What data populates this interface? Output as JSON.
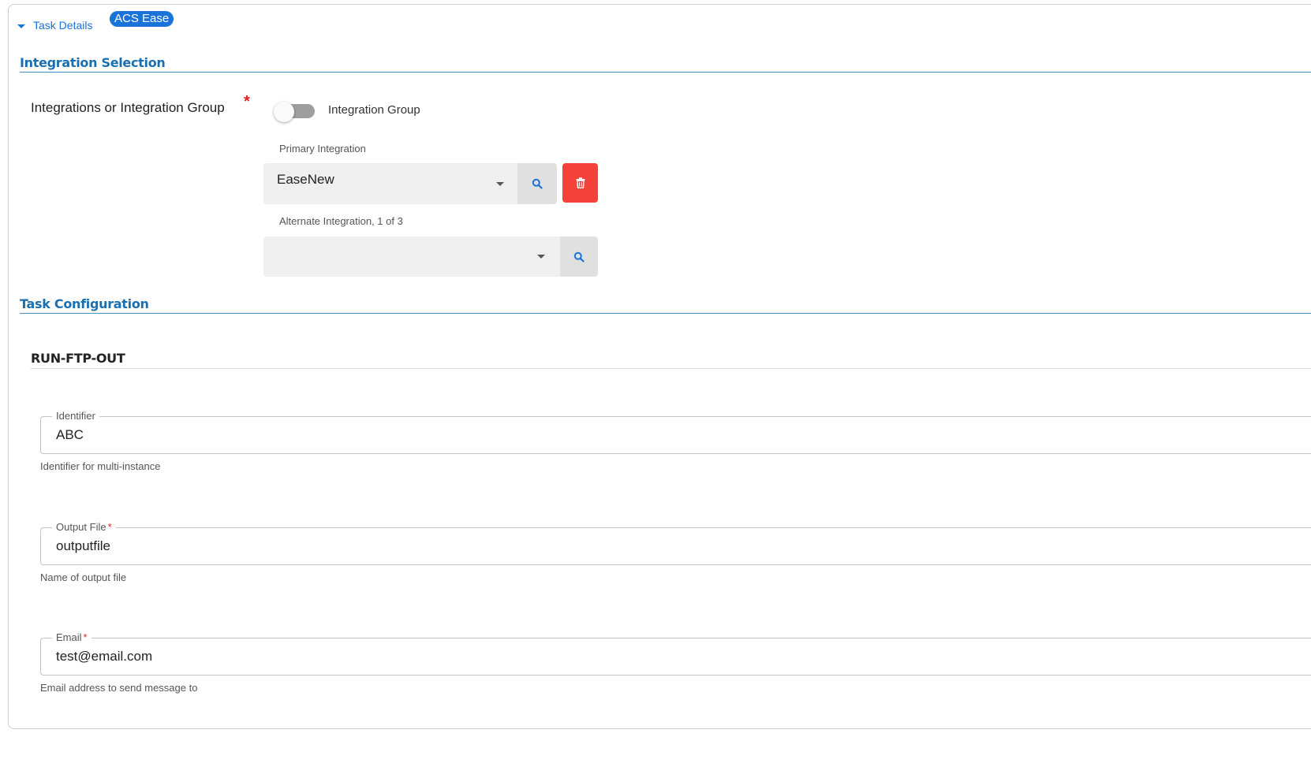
{
  "header": {
    "task_details_label": "Task Details",
    "badge": "ACS Ease"
  },
  "integration_selection": {
    "title": "Integration Selection",
    "field_label": "Integrations or Integration Group",
    "required_mark": "*",
    "toggle": {
      "label": "Integration Group",
      "on": false
    },
    "primary": {
      "label": "Primary Integration",
      "value": "EaseNew"
    },
    "alternate": {
      "label": "Alternate Integration, 1 of 3",
      "value": ""
    }
  },
  "task_configuration": {
    "title": "Task Configuration",
    "task_name": "RUN-FTP-OUT",
    "fields": [
      {
        "label": "Identifier",
        "required": false,
        "value": "ABC",
        "helper": "Identifier for multi-instance"
      },
      {
        "label": "Output File",
        "required": true,
        "required_mark": "*",
        "value": "outputfile",
        "helper": "Name of output file"
      },
      {
        "label": "Email",
        "required": true,
        "required_mark": "*",
        "value": "test@email.com",
        "helper": "Email address to send message to"
      }
    ]
  },
  "colors": {
    "accent": "#1a73d9",
    "section_title": "#1a6fb0",
    "danger": "#f4413a",
    "required": "#e32020"
  },
  "icons": [
    "caret-down-icon",
    "search-icon",
    "trash-icon",
    "dropdown-caret-icon"
  ]
}
